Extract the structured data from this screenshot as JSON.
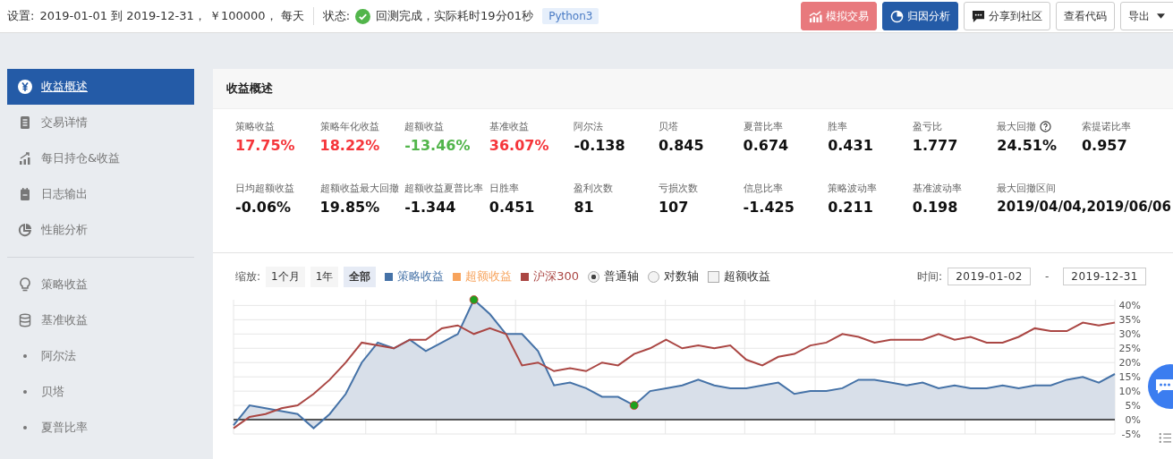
{
  "topbar": {
    "settings_label": "设置:",
    "settings": "2019-01-01 到 2019-12-31， ￥100000， 每天",
    "status_label": "状态:",
    "status": "回测完成，实际耗时19分01秒",
    "badge": "Python3",
    "buttons": [
      {
        "label": "模拟交易",
        "kind": "disabled"
      },
      {
        "label": "归因分析",
        "kind": "primary"
      },
      {
        "label": "分享到社区",
        "kind": "default"
      },
      {
        "label": "查看代码",
        "kind": "default"
      },
      {
        "label": "导出",
        "kind": "dropdown"
      }
    ]
  },
  "sidebar": {
    "items": [
      {
        "label": "收益概述",
        "selected": true
      },
      {
        "label": "交易详情",
        "selected": false
      },
      {
        "label": "每日持仓&收益",
        "selected": false
      },
      {
        "label": "日志输出",
        "selected": false
      },
      {
        "label": "性能分析",
        "selected": false
      },
      {
        "label": "策略收益",
        "selected": false
      },
      {
        "label": "基准收益",
        "selected": false
      },
      {
        "label": "阿尔法",
        "selected": false
      },
      {
        "label": "贝塔",
        "selected": false
      },
      {
        "label": "夏普比率",
        "selected": false
      }
    ]
  },
  "panel": {
    "title": "收益概述",
    "metrics": [
      [
        {
          "label": "策略收益",
          "value": "17.75%",
          "color": "#f5363b"
        },
        {
          "label": "策略年化收益",
          "value": "18.22%",
          "color": "#f5363b"
        },
        {
          "label": "超额收益",
          "value": "-13.46%",
          "color": "#52b54b"
        },
        {
          "label": "基准收益",
          "value": "36.07%",
          "color": "#f5363b"
        },
        {
          "label": "阿尔法",
          "value": "-0.138"
        },
        {
          "label": "贝塔",
          "value": "0.845"
        },
        {
          "label": "夏普比率",
          "value": "0.674"
        },
        {
          "label": "胜率",
          "value": "0.431"
        },
        {
          "label": "盈亏比",
          "value": "1.777"
        },
        {
          "label": "最大回撤",
          "value": "24.51%",
          "help": true
        },
        {
          "label": "索提诺比率",
          "value": "0.957"
        }
      ],
      [
        {
          "label": "日均超额收益",
          "value": "-0.06%"
        },
        {
          "label": "超额收益最大回撤",
          "value": "19.85%"
        },
        {
          "label": "超额收益夏普比率",
          "value": "-1.344"
        },
        {
          "label": "日胜率",
          "value": "0.451"
        },
        {
          "label": "盈利次数",
          "value": "81"
        },
        {
          "label": "亏损次数",
          "value": "107"
        },
        {
          "label": "信息比率",
          "value": "-1.425"
        },
        {
          "label": "策略波动率",
          "value": "0.211"
        },
        {
          "label": "基准波动率",
          "value": "0.198"
        },
        {
          "label": "最大回撤区间",
          "value": "2019/04/04,2019/06/06"
        }
      ]
    ],
    "chart_toolbar": {
      "zoom_label": "缩放:",
      "zoom": [
        {
          "label": "1个月",
          "selected": false
        },
        {
          "label": "1年",
          "selected": false
        },
        {
          "label": "全部",
          "selected": true
        }
      ],
      "excess_legend": {
        "label": "超额收益",
        "color": "#f7a35c"
      },
      "axis": [
        {
          "label": "普通轴",
          "selected": true
        },
        {
          "label": "对数轴",
          "selected": false
        }
      ],
      "excess_checkbox": {
        "label": "超额收益",
        "checked": false
      },
      "time_label": "时间:",
      "start": "2019-01-02",
      "sep": "-",
      "end": "2019-12-31"
    },
    "chart_data": {
      "type": "line",
      "grid": true,
      "ylim": [
        -5,
        42
      ],
      "yticks": [
        {
          "value": -5,
          "label": "-5%"
        },
        {
          "value": 0,
          "label": "0%"
        },
        {
          "value": 5,
          "label": "5%"
        },
        {
          "value": 10,
          "label": "10%"
        },
        {
          "value": 15,
          "label": "15%"
        },
        {
          "value": 20,
          "label": "20%"
        },
        {
          "value": 25,
          "label": "25%"
        },
        {
          "value": 30,
          "label": "30%"
        },
        {
          "value": 35,
          "label": "35%"
        },
        {
          "value": 40,
          "label": "40%"
        }
      ],
      "series": [
        {
          "name": "策略收益",
          "color": "#4572a7",
          "type": "area",
          "values": [
            -2,
            5,
            4,
            3,
            2,
            -3,
            2,
            9,
            20,
            27,
            25,
            28,
            24,
            27,
            30,
            42,
            37,
            30,
            30,
            24,
            12,
            13,
            11,
            8,
            8,
            5,
            10,
            11,
            12,
            14,
            12,
            11,
            11,
            12,
            13,
            9,
            10,
            10,
            11,
            14,
            14,
            13,
            12,
            13,
            11,
            12,
            11,
            11,
            12,
            11,
            12,
            12,
            14,
            15,
            13,
            16
          ]
        },
        {
          "name": "沪深300",
          "color": "#aa4643",
          "type": "line",
          "values": [
            -3,
            1,
            2,
            4,
            5,
            9,
            14,
            20,
            27,
            26,
            25,
            28,
            28,
            32,
            33,
            30,
            32,
            30,
            19,
            20,
            17,
            18,
            17,
            20,
            19,
            23,
            25,
            28,
            25,
            26,
            25,
            26,
            21,
            19,
            22,
            23,
            26,
            27,
            30,
            29,
            27,
            28,
            28,
            28,
            30,
            28,
            29,
            27,
            27,
            29,
            32,
            31,
            31,
            34,
            33,
            34
          ]
        }
      ]
    }
  }
}
